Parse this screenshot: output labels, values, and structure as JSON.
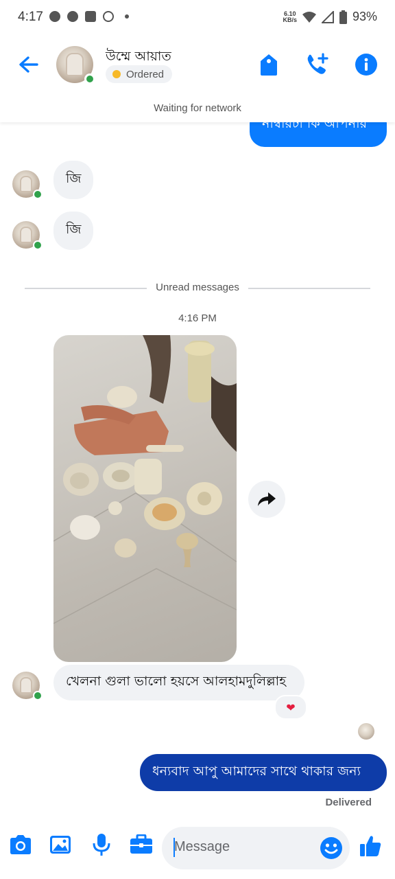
{
  "status_bar": {
    "time": "4:17",
    "net_speed_top": "6.10",
    "net_speed_bottom": "KB/s",
    "battery": "93%"
  },
  "header": {
    "contact_name": "উম্মে আয়াত",
    "status_label": "Ordered",
    "network_notice": "Waiting for network",
    "icons": [
      "back-arrow-icon",
      "tag-icon",
      "add-call-icon",
      "info-icon"
    ]
  },
  "messages": {
    "outgoing_partial": "নাম্বারটা কি আপনার",
    "incoming_1": "জি",
    "incoming_2": "জি",
    "unread_divider": "Unread messages",
    "timestamp": "4:16 PM",
    "incoming_caption": "খেলনা গুলা ভালো হয়সে আলহামদুলিল্লাহ",
    "reaction": "❤",
    "outgoing_last": "ধন্যবাদ আপু আমাদের সাথে থাকার জন্য",
    "delivery_status": "Delivered"
  },
  "composer": {
    "placeholder": "Message",
    "icons": [
      "camera-icon",
      "gallery-icon",
      "microphone-icon",
      "briefcase-icon",
      "emoji-icon",
      "thumbs-up-icon"
    ]
  },
  "colors": {
    "accent": "#0a7cff",
    "dark_bubble": "#0e3ca8",
    "incoming_bubble": "#f0f2f5",
    "online": "#31a24c",
    "status_dot": "#f7b928"
  }
}
